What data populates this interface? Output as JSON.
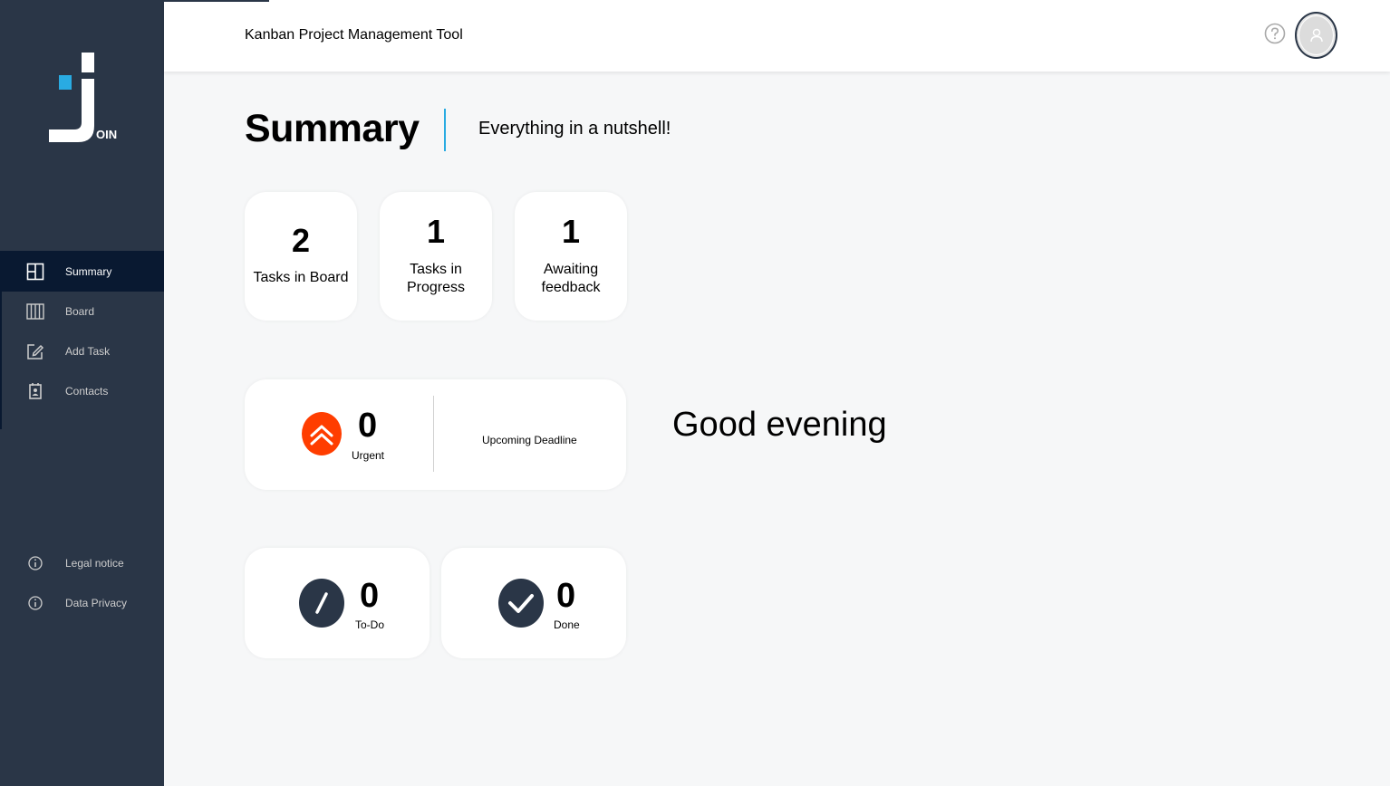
{
  "app": {
    "title": "Kanban Project Management Tool",
    "logo_text": "OIN"
  },
  "sidebar": {
    "items": [
      {
        "label": "Summary",
        "icon": "summary-icon",
        "active": true
      },
      {
        "label": "Board",
        "icon": "board-icon",
        "active": false
      },
      {
        "label": "Add Task",
        "icon": "add-task-icon",
        "active": false
      },
      {
        "label": "Contacts",
        "icon": "contacts-icon",
        "active": false
      }
    ],
    "footer_items": [
      {
        "label": "Legal notice",
        "icon": "info-icon"
      },
      {
        "label": "Data Privacy",
        "icon": "info-icon"
      }
    ]
  },
  "header": {
    "help_icon": "help-icon",
    "avatar_icon": "user-avatar-icon"
  },
  "summary": {
    "title": "Summary",
    "subtitle": "Everything in a nutshell!",
    "stats": [
      {
        "value": "2",
        "label": "Tasks in Board"
      },
      {
        "value": "1",
        "label_line1": "Tasks in",
        "label_line2": "Progress"
      },
      {
        "value": "1",
        "label_line1": "Awaiting",
        "label_line2": "feedback"
      }
    ],
    "urgent": {
      "value": "0",
      "label": "Urgent",
      "deadline_label": "Upcoming Deadline"
    },
    "todo": {
      "value": "0",
      "label": "To-Do"
    },
    "done": {
      "value": "0",
      "label": "Done"
    },
    "greeting": "Good evening"
  },
  "colors": {
    "sidebar": "#2a3647",
    "active": "#091931",
    "accent": "#29abe2",
    "urgent": "#ff3d00"
  }
}
